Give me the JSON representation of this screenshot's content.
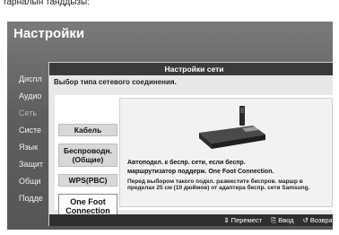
{
  "top_strip": {
    "text": "тарналын танддызы:"
  },
  "background": {
    "title": "Настройки",
    "menu": [
      {
        "label": "Диспл",
        "dim": false
      },
      {
        "label": "Аудио",
        "dim": false
      },
      {
        "label": "Сеть",
        "dim": true
      },
      {
        "label": "Систе",
        "dim": false
      },
      {
        "label": "Язык",
        "dim": false
      },
      {
        "label": "Защит",
        "dim": false
      },
      {
        "label": "Общи",
        "dim": false
      },
      {
        "label": "Подде",
        "dim": false
      }
    ]
  },
  "dialog": {
    "title": "Настройки сети",
    "subtitle": "Выбор типа сетевого соединения.",
    "options": {
      "cable": "Кабель",
      "wireless_1": "Беспроводн.",
      "wireless_2": "(Общие)",
      "wps": "WPS(PBC)",
      "onefoot_1": "One Foot",
      "onefoot_2": "Connection"
    },
    "selected_option": "One Foot Connection",
    "info": {
      "line1": "Автоподкл. к беспр. сети, если беспр.",
      "line2": "маршрутизатор поддерж. One Foot Connection.",
      "note": "Перед выбором такого подкл. разместите беспров. маршр в пределах 25 см (10 дюймов) от адаптера беспр. сети Samsung."
    },
    "footer": {
      "move": "Перемест",
      "enter": "Ввод",
      "back": "Возврат"
    }
  },
  "icons": {
    "move": "updown-arrows-icon",
    "enter": "enter-icon",
    "back": "return-icon"
  }
}
